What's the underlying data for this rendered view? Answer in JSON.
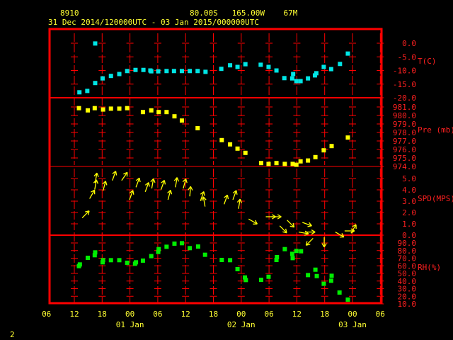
{
  "header": {
    "station": "8910",
    "location": "80.00S   165.00W    67M",
    "period": "31 Dec 2014/120000UTC - 03 Jan 2015/000000UTC"
  },
  "page_number": "2",
  "colors": {
    "frame": "#ff0000",
    "text": "#ffff33",
    "temp": "#00e5e5",
    "pressure": "#ffff00",
    "wind": "#ffff00",
    "rh": "#00ee00"
  },
  "chart_data": {
    "type": "scatter",
    "x_unit": "hours since 31 Dec 2014 12UTC",
    "x_ticks": [
      {
        "h": -6,
        "label": "06"
      },
      {
        "h": 0,
        "label": "12"
      },
      {
        "h": 6,
        "label": "18"
      },
      {
        "h": 12,
        "label": "00"
      },
      {
        "h": 18,
        "label": "06"
      },
      {
        "h": 24,
        "label": "12"
      },
      {
        "h": 30,
        "label": "18"
      },
      {
        "h": 36,
        "label": "00"
      },
      {
        "h": 42,
        "label": "06"
      },
      {
        "h": 48,
        "label": "12"
      },
      {
        "h": 54,
        "label": "18"
      },
      {
        "h": 60,
        "label": "00"
      },
      {
        "h": 66,
        "label": "06"
      }
    ],
    "date_labels": [
      {
        "h": 12,
        "label": "01 Jan"
      },
      {
        "h": 36,
        "label": "02 Jan"
      },
      {
        "h": 60,
        "label": "03 Jan"
      }
    ],
    "panels": [
      {
        "name": "temperature",
        "label": "T(C)",
        "type": "scatter",
        "ylim": [
          -20,
          0
        ],
        "ticks": [
          {
            "v": 0,
            "label": "0.0"
          },
          {
            "v": -5,
            "label": "-5.0"
          },
          {
            "v": -10,
            "label": "-10.0"
          },
          {
            "v": -15,
            "label": "-15.0"
          },
          {
            "v": -20,
            "label": "-20.0"
          }
        ],
        "points": [
          [
            1.1,
            -18.0
          ],
          [
            2.8,
            -17.5
          ],
          [
            4.5,
            -0.1
          ],
          [
            4.5,
            -14.6
          ],
          [
            6.1,
            -12.9
          ],
          [
            7.9,
            -12.0
          ],
          [
            9.7,
            -11.3
          ],
          [
            11.4,
            -10.2
          ],
          [
            13.2,
            -9.8
          ],
          [
            14.9,
            -9.8
          ],
          [
            16.4,
            -10.0
          ],
          [
            16.6,
            -10.3
          ],
          [
            18.1,
            -10.3
          ],
          [
            19.9,
            -10.2
          ],
          [
            21.5,
            -10.2
          ],
          [
            23.2,
            -10.2
          ],
          [
            24.9,
            -10.2
          ],
          [
            26.6,
            -10.2
          ],
          [
            28.3,
            -10.5
          ],
          [
            31.7,
            -9.4
          ],
          [
            33.6,
            -8.1
          ],
          [
            35.2,
            -8.7
          ],
          [
            36.9,
            -7.7
          ],
          [
            40.2,
            -7.9
          ],
          [
            41.9,
            -8.7
          ],
          [
            43.6,
            -10.0
          ],
          [
            45.3,
            -12.8
          ],
          [
            47.0,
            -12.9
          ],
          [
            47.2,
            -11.3
          ],
          [
            47.9,
            -13.9
          ],
          [
            48.8,
            -13.9
          ],
          [
            50.4,
            -12.9
          ],
          [
            51.9,
            -11.8
          ],
          [
            52.2,
            -11.0
          ],
          [
            53.8,
            -8.7
          ],
          [
            55.4,
            -9.5
          ],
          [
            57.3,
            -7.6
          ],
          [
            59.0,
            -3.8
          ]
        ]
      },
      {
        "name": "pressure",
        "label": "Pre (mb)",
        "type": "scatter",
        "ylim": [
          974,
          981
        ],
        "ticks": [
          {
            "v": 981,
            "label": "981.0"
          },
          {
            "v": 980,
            "label": "980.0"
          },
          {
            "v": 979,
            "label": "979.0"
          },
          {
            "v": 978,
            "label": "978.0"
          },
          {
            "v": 977,
            "label": "977.0"
          },
          {
            "v": 976,
            "label": "976.0"
          },
          {
            "v": 975,
            "label": "975.0"
          },
          {
            "v": 974,
            "label": "974.0"
          }
        ],
        "points": [
          [
            1.0,
            980.86
          ],
          [
            2.9,
            980.6
          ],
          [
            4.4,
            980.86
          ],
          [
            6.2,
            980.7
          ],
          [
            7.9,
            980.8
          ],
          [
            9.7,
            980.8
          ],
          [
            11.4,
            980.86
          ],
          [
            14.8,
            980.4
          ],
          [
            16.6,
            980.6
          ],
          [
            18.2,
            980.4
          ],
          [
            19.9,
            980.4
          ],
          [
            21.6,
            979.9
          ],
          [
            23.2,
            979.4
          ],
          [
            26.6,
            978.5
          ],
          [
            31.8,
            977.1
          ],
          [
            33.6,
            976.6
          ],
          [
            35.2,
            976.1
          ],
          [
            36.9,
            975.6
          ],
          [
            40.3,
            974.4
          ],
          [
            41.9,
            974.3
          ],
          [
            43.6,
            974.4
          ],
          [
            45.4,
            974.3
          ],
          [
            47.1,
            974.3
          ],
          [
            47.9,
            974.2
          ],
          [
            48.8,
            974.6
          ],
          [
            50.4,
            974.7
          ],
          [
            52.0,
            975.1
          ],
          [
            53.8,
            975.9
          ],
          [
            55.5,
            976.4
          ],
          [
            59.0,
            977.4
          ]
        ]
      },
      {
        "name": "wind",
        "label": "SPD(MPS)",
        "type": "vector",
        "ylim": [
          0,
          5
        ],
        "ticks": [
          {
            "v": 5,
            "label": "5.0"
          },
          {
            "v": 4,
            "label": "4.0"
          },
          {
            "v": 3,
            "label": "3.0"
          },
          {
            "v": 2,
            "label": "2.0"
          },
          {
            "v": 1,
            "label": "1.0"
          },
          {
            "v": 0,
            "label": "0.0"
          }
        ],
        "points_h_speed_dir": [
          [
            1.7,
            1.9,
            45
          ],
          [
            3.3,
            3.6,
            30
          ],
          [
            4.4,
            4.4,
            10
          ],
          [
            4.5,
            5.0,
            10
          ],
          [
            6.2,
            4.3,
            15
          ],
          [
            8.2,
            5.2,
            20
          ],
          [
            10.2,
            5.2,
            35
          ],
          [
            11.9,
            3.5,
            20
          ],
          [
            13.3,
            4.6,
            20
          ],
          [
            15.3,
            4.2,
            20
          ],
          [
            16.7,
            4.5,
            10
          ],
          [
            18.7,
            4.4,
            20
          ],
          [
            20.2,
            3.5,
            15
          ],
          [
            21.8,
            4.6,
            10
          ],
          [
            23.5,
            4.5,
            15
          ],
          [
            24.9,
            3.8,
            5
          ],
          [
            27.2,
            3.4,
            20
          ],
          [
            28.2,
            2.9,
            350
          ],
          [
            32.3,
            3.1,
            20
          ],
          [
            34.2,
            3.5,
            20
          ],
          [
            35.4,
            2.7,
            10
          ],
          [
            37.6,
            1.8,
            120
          ],
          [
            41.3,
            2.0,
            90
          ],
          [
            42.5,
            2.0,
            90
          ],
          [
            44.3,
            1.2,
            135
          ],
          [
            45.9,
            1.7,
            135
          ],
          [
            49.2,
            1.5,
            110
          ],
          [
            48.4,
            0.65,
            100
          ],
          [
            49.8,
            0.65,
            90
          ],
          [
            51.5,
            0.1,
            225
          ],
          [
            53.9,
            0.2,
            180
          ],
          [
            56.3,
            0.65,
            120
          ],
          [
            58.3,
            0.75,
            90
          ],
          [
            59.7,
            0.55,
            30
          ]
        ]
      },
      {
        "name": "relative-humidity",
        "label": "RH(%)",
        "type": "scatter",
        "ylim": [
          10,
          90
        ],
        "ticks": [
          {
            "v": 90,
            "label": "90.0"
          },
          {
            "v": 80,
            "label": "80.0"
          },
          {
            "v": 70,
            "label": "70.0"
          },
          {
            "v": 60,
            "label": "60.0"
          },
          {
            "v": 50,
            "label": "50.0"
          },
          {
            "v": 40,
            "label": "40.0"
          },
          {
            "v": 30,
            "label": "30.0"
          },
          {
            "v": 20,
            "label": "20.0"
          },
          {
            "v": 10,
            "label": "10.0"
          }
        ],
        "points": [
          [
            1.0,
            59.6
          ],
          [
            1.2,
            61.8
          ],
          [
            2.9,
            70.5
          ],
          [
            4.4,
            73.9
          ],
          [
            4.5,
            77.6
          ],
          [
            6.2,
            67.4
          ],
          [
            6.1,
            64.6
          ],
          [
            7.9,
            67.4
          ],
          [
            9.7,
            67.4
          ],
          [
            11.4,
            64.0
          ],
          [
            13.1,
            62.7
          ],
          [
            13.3,
            64.6
          ],
          [
            14.8,
            66.8
          ],
          [
            16.6,
            72.7
          ],
          [
            18.1,
            78.2
          ],
          [
            18.2,
            81.9
          ],
          [
            19.9,
            85.0
          ],
          [
            21.6,
            89.1
          ],
          [
            23.2,
            89.7
          ],
          [
            24.9,
            83.2
          ],
          [
            26.7,
            85.3
          ],
          [
            28.2,
            74.5
          ],
          [
            31.8,
            67.7
          ],
          [
            33.6,
            67.4
          ],
          [
            35.2,
            55.6
          ],
          [
            36.8,
            44.7
          ],
          [
            37.0,
            41.3
          ],
          [
            40.3,
            41.6
          ],
          [
            41.9,
            45.6
          ],
          [
            43.6,
            67.7
          ],
          [
            43.7,
            71.4
          ],
          [
            45.4,
            81.9
          ],
          [
            47.0,
            75.7
          ],
          [
            47.1,
            70.1
          ],
          [
            47.9,
            79.5
          ],
          [
            48.9,
            79.1
          ],
          [
            50.4,
            47.8
          ],
          [
            52.0,
            54.9
          ],
          [
            52.3,
            46.5
          ],
          [
            53.8,
            36.4
          ],
          [
            55.4,
            40.4
          ],
          [
            55.5,
            46.9
          ],
          [
            57.2,
            24.9
          ],
          [
            59.0,
            15.6
          ]
        ]
      }
    ]
  }
}
